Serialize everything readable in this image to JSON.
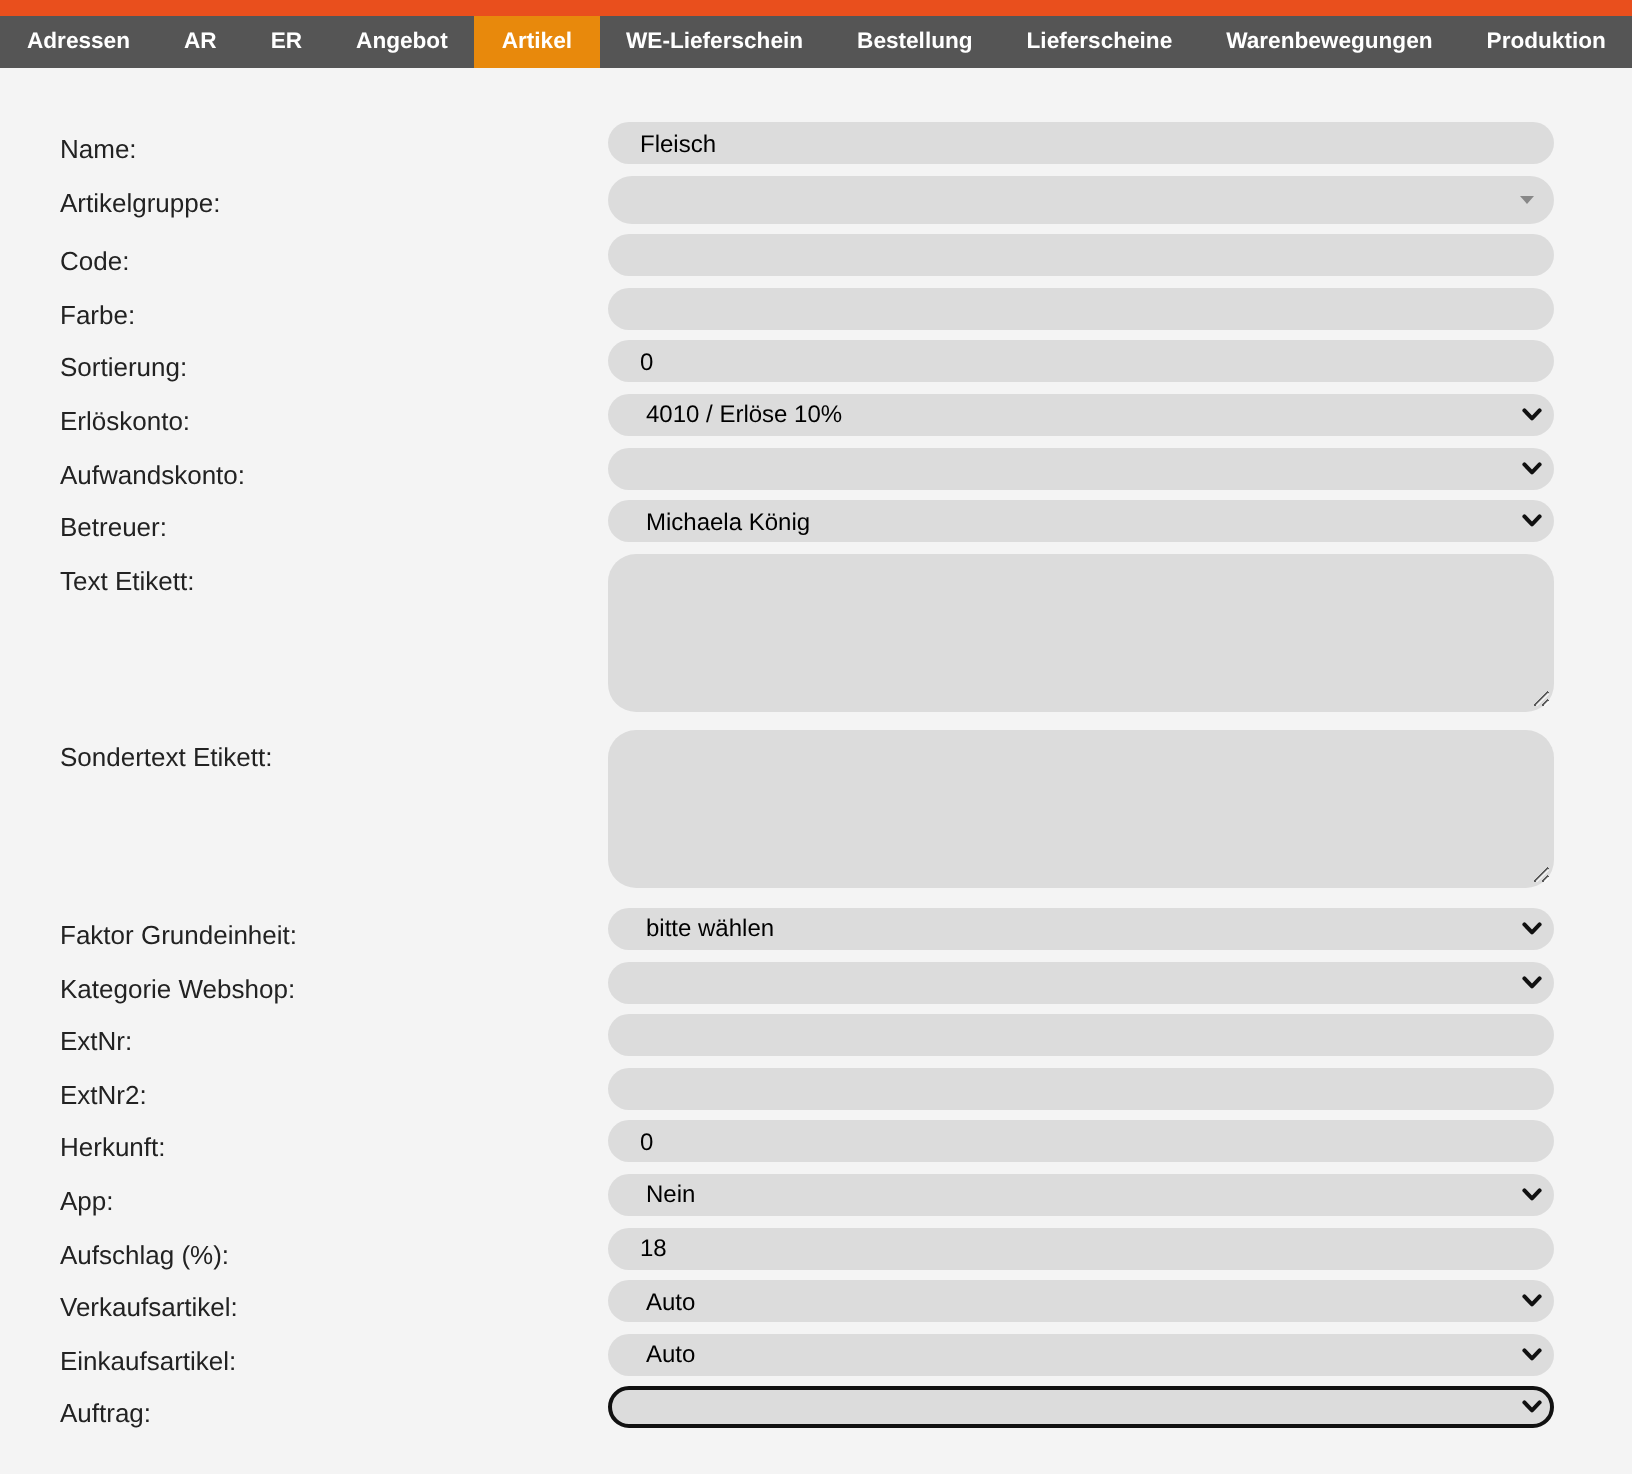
{
  "nav": {
    "tabs": [
      {
        "label": "Adressen",
        "selected": false
      },
      {
        "label": "AR",
        "selected": false
      },
      {
        "label": "ER",
        "selected": false
      },
      {
        "label": "Angebot",
        "selected": false
      },
      {
        "label": "Artikel",
        "selected": true
      },
      {
        "label": "WE-Lieferschein",
        "selected": false
      },
      {
        "label": "Bestellung",
        "selected": false
      },
      {
        "label": "Lieferscheine",
        "selected": false
      },
      {
        "label": "Warenbewegungen",
        "selected": false
      },
      {
        "label": "Produktion",
        "selected": false
      }
    ]
  },
  "form": {
    "fields": [
      {
        "label": "Name:",
        "kind": "text",
        "value": "Fleisch",
        "focused": false
      },
      {
        "label": "Artikelgruppe:",
        "kind": "combo",
        "focused": false
      },
      {
        "label": "Code:",
        "kind": "text",
        "focused": false
      },
      {
        "label": "Farbe:",
        "kind": "text",
        "focused": false
      },
      {
        "label": "Sortierung:",
        "kind": "text",
        "value": "0",
        "focused": false
      },
      {
        "label": "Erlöskonto:",
        "kind": "select",
        "value": "4010 / Erlöse 10%",
        "focused": false
      },
      {
        "label": "Aufwandskonto:",
        "kind": "select",
        "focused": false
      },
      {
        "label": "Betreuer:",
        "kind": "select",
        "value": "Michaela König",
        "focused": false
      },
      {
        "label": "Text Etikett:",
        "kind": "textarea",
        "focused": false
      },
      {
        "label": "Sondertext Etikett:",
        "kind": "textarea",
        "focused": false
      },
      {
        "label": "Faktor Grundeinheit:",
        "kind": "select",
        "value": "bitte wählen",
        "focused": false
      },
      {
        "label": "Kategorie Webshop:",
        "kind": "select",
        "focused": false
      },
      {
        "label": "ExtNr:",
        "kind": "text",
        "focused": false
      },
      {
        "label": "ExtNr2:",
        "kind": "text",
        "focused": false
      },
      {
        "label": "Herkunft:",
        "kind": "text",
        "value": "0",
        "focused": false
      },
      {
        "label": "App:",
        "kind": "select",
        "value": "Nein",
        "focused": false
      },
      {
        "label": "Aufschlag (%):",
        "kind": "text",
        "value": "18",
        "focused": false
      },
      {
        "label": "Verkaufsartikel:",
        "kind": "select",
        "value": "Auto",
        "focused": false
      },
      {
        "label": "Einkaufsartikel:",
        "kind": "select",
        "value": "Auto",
        "focused": false
      },
      {
        "label": "Auftrag:",
        "kind": "select",
        "focused": true
      }
    ]
  }
}
